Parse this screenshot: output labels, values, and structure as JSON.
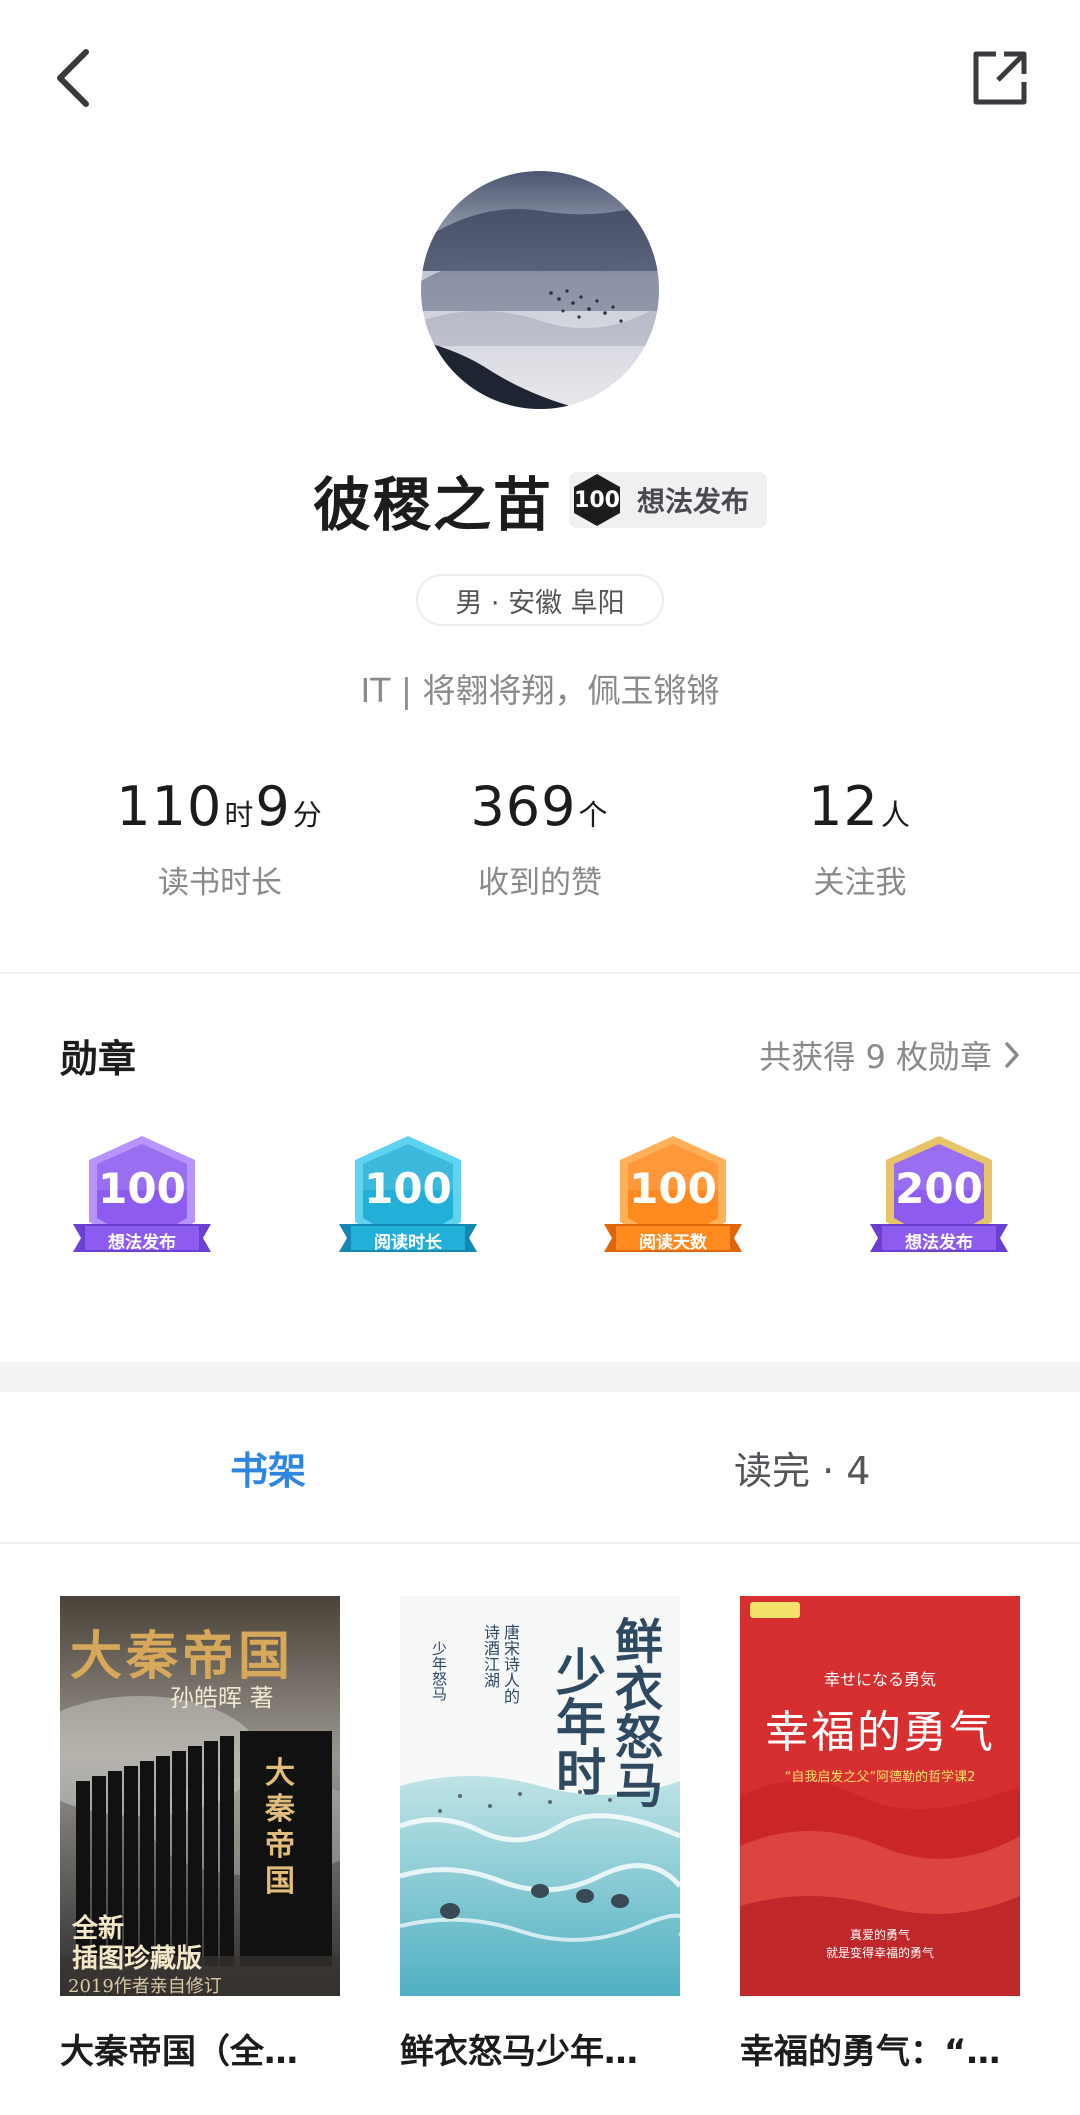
{
  "topbar": {
    "back_icon": "chevron-left-icon",
    "share_icon": "external-share-icon"
  },
  "profile": {
    "avatar_alt": "misty-mountain-landscape",
    "name": "彼稷之苗",
    "badge_number": "100",
    "badge_label": "想法发布",
    "meta": "男 · 安徽 阜阳",
    "signature": "IT  |  将翱将翔，佩玉锵锵"
  },
  "stats": {
    "reading_time": {
      "hours": "110",
      "hours_unit": "时",
      "minutes": "9",
      "minutes_unit": "分",
      "label": "读书时长"
    },
    "likes": {
      "value": "369",
      "unit": "个",
      "label": "收到的赞"
    },
    "followers": {
      "value": "12",
      "unit": "人",
      "label": "关注我"
    }
  },
  "medals": {
    "title": "勋章",
    "summary": "共获得 9 枚勋章",
    "items": [
      {
        "number": "100",
        "label": "想法发布",
        "color": "#8d5bf0",
        "color_dark": "#6b3fd1",
        "ribbon": "#b794ff"
      },
      {
        "number": "100",
        "label": "阅读时长",
        "color": "#22b0d8",
        "color_dark": "#1488b3",
        "ribbon": "#5fd3ef"
      },
      {
        "number": "100",
        "label": "阅读天数",
        "color": "#ff8a1f",
        "color_dark": "#e0650a",
        "ribbon": "#ffb05a"
      },
      {
        "number": "200",
        "label": "想法发布",
        "color": "#8d5bf0",
        "color_dark": "#6b3fd1",
        "ribbon": "#e7c46a"
      }
    ]
  },
  "tabs": {
    "shelf": "书架",
    "finished": "读完 · 4"
  },
  "books": [
    {
      "title": "大秦帝国（全…",
      "cover": {
        "title": "大秦帝国",
        "author": "孙皓晖 著",
        "sub": "全新\n插图珍藏版",
        "small": "2019作者亲自修订",
        "box_title": "大秦帝国"
      }
    },
    {
      "title": "鲜衣怒马少年…",
      "cover": {
        "big1": "鲜衣怒马",
        "big2": "少年时",
        "vert1": "唐宋诗人的",
        "vert2": "诗酒江湖",
        "vert3": "少年怒马"
      }
    },
    {
      "title": "幸福的勇气：“…",
      "cover": {
        "kicker": "幸せになる勇気",
        "title": "幸福的勇气",
        "sub": "“自我启发之父”阿德勒的哲学课2",
        "foot": "真爱的勇气\n就是变得幸福的勇气"
      }
    }
  ]
}
